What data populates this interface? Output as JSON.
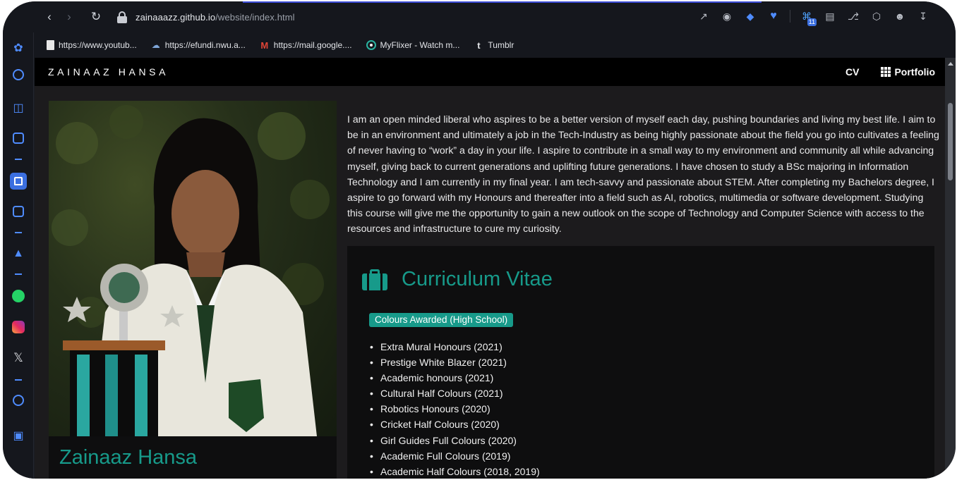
{
  "browser": {
    "url_domain": "zainaaazz.github.io",
    "url_path": "/website/index.html",
    "bookmarks": [
      {
        "label": "https://www.youtub...",
        "icon": "page-icon"
      },
      {
        "label": "https://efundi.nwu.a...",
        "icon": "cloud-icon"
      },
      {
        "label": "https://mail.google....",
        "icon": "gmail-icon"
      },
      {
        "label": "MyFlixer - Watch m...",
        "icon": "myflixer-icon"
      },
      {
        "label": "Tumblr",
        "icon": "tumblr-icon"
      }
    ],
    "extension_badge": "11"
  },
  "site": {
    "brand": "ZAINAAZ HANSA",
    "nav": {
      "cv": "CV",
      "portfolio": "Portfolio"
    },
    "profile": {
      "name": "Zainaaz Hansa"
    },
    "bio": "I am an open minded liberal who aspires to be a better version of myself each day, pushing boundaries and living my best life. I aim to be in an environment and ultimately a job in the Tech-Industry as being highly passionate about the field you go into cultivates a feeling of never having to “work” a day in your life. I aspire to contribute in a small way to my environment and community all while advancing myself, giving back to current generations and uplifting future generations. I have chosen to study a BSc majoring in Information Technology and I am currently in my final year. I am tech-savvy and passionate about STEM. After completing my Bachelors degree, I aspire to go forward with my Honours and thereafter into a field such as AI, robotics, multimedia or software development. Studying this course will give me the opportunity to gain a new outlook on the scope of Technology and Computer Science with access to the resources and infrastructure to cure my curiosity.",
    "cv": {
      "title": "Curriculum Vitae",
      "tag": "Colours Awarded (High School)",
      "items": [
        "Extra Mural Honours (2021)",
        "Prestige White Blazer (2021)",
        "Academic honours (2021)",
        "Cultural Half Colours (2021)",
        "Robotics Honours (2020)",
        "Cricket Half Colours (2020)",
        "Girl Guides Full Colours (2020)",
        "Academic Full Colours (2019)",
        "Academic Half Colours (2018, 2019)"
      ]
    }
  },
  "colors": {
    "accent": "#179a8a",
    "nav_bg": "#000000",
    "page_bg": "#1c1b1d",
    "card_bg": "#0e0e0f"
  }
}
